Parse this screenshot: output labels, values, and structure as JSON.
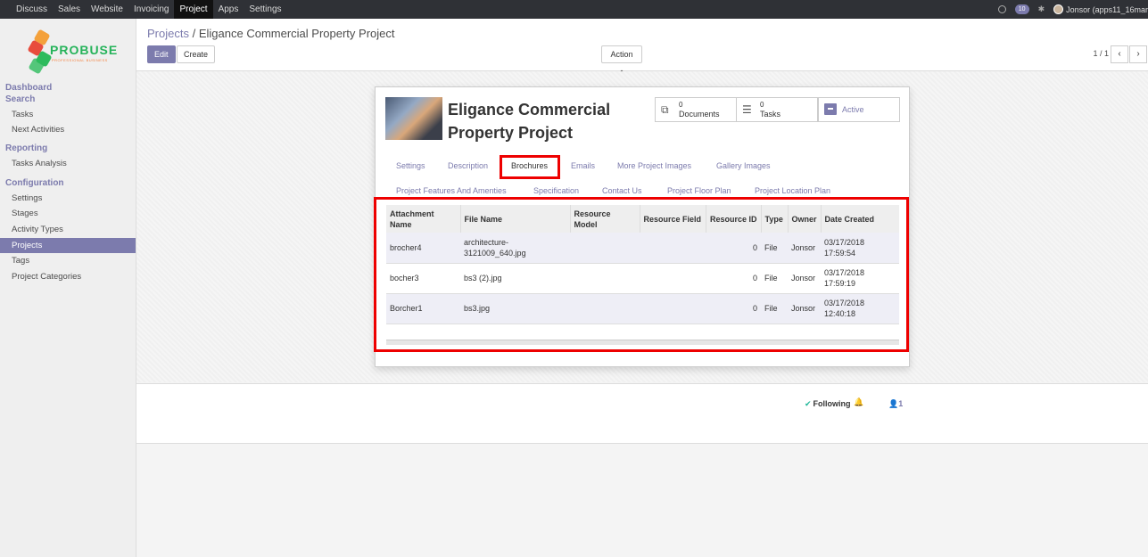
{
  "topbar": {
    "menu": [
      "Discuss",
      "Sales",
      "Website",
      "Invoicing",
      "Project",
      "Apps",
      "Settings"
    ],
    "active_menu": "Project",
    "badge": "10",
    "user": "Jonsor (apps11_16mar"
  },
  "logo": {
    "name": "PROBUSE",
    "tagline": "PROFESSIONAL BUSINESS"
  },
  "sidebar": {
    "sections": [
      {
        "title": "Dashboard",
        "items": []
      },
      {
        "title": "Search",
        "items": [
          "Tasks",
          "Next Activities"
        ]
      },
      {
        "title": "Reporting",
        "items": [
          "Tasks Analysis"
        ]
      },
      {
        "title": "Configuration",
        "items": [
          "Settings",
          "Stages",
          "Activity Types",
          "Projects",
          "Tags",
          "Project Categories"
        ]
      }
    ],
    "active_item": "Projects"
  },
  "control_panel": {
    "breadcrumb_parent": "Projects",
    "breadcrumb_sep": "/",
    "breadcrumb_current": "Eligance Commercial Property Project",
    "edit_label": "Edit",
    "create_label": "Create",
    "action_label": "Action -",
    "pager": "1 / 1",
    "prev_icon": "‹",
    "next_icon": "›"
  },
  "record": {
    "title_line1": "Eligance Commercial",
    "title_line2": "Property Project",
    "stats": [
      {
        "value": "0",
        "label": "Documents",
        "icon": "documents-icon"
      },
      {
        "value": "0",
        "label": "Tasks",
        "icon": "tasks-icon"
      },
      {
        "value": "",
        "label": "Active",
        "icon": "archive-icon"
      }
    ]
  },
  "tabs_row1": [
    "Settings",
    "Description",
    "Brochures",
    "Emails",
    "More Project Images",
    "Gallery Images"
  ],
  "tabs_row2": [
    "Project Features And Amenties",
    "Specification",
    "Contact Us",
    "Project Floor Plan",
    "Project Location Plan"
  ],
  "selected_tab": "Brochures",
  "attachments": {
    "columns": [
      "Attachment Name",
      "File Name",
      "Resource Model",
      "Resource Field",
      "Resource ID",
      "Type",
      "Owner",
      "Date Created"
    ],
    "rows": [
      [
        "brocher4",
        "architecture-3121009_640.jpg",
        "",
        "",
        "0",
        "File",
        "Jonsor",
        "03/17/2018 17:59:54"
      ],
      [
        "bocher3",
        "bs3 (2).jpg",
        "",
        "",
        "0",
        "File",
        "Jonsor",
        "03/17/2018 17:59:19"
      ],
      [
        "Borcher1",
        "bs3.jpg",
        "",
        "",
        "0",
        "File",
        "Jonsor",
        "03/17/2018 12:40:18"
      ]
    ]
  },
  "chatter": {
    "following_label": "Following",
    "followers_count": "1"
  }
}
